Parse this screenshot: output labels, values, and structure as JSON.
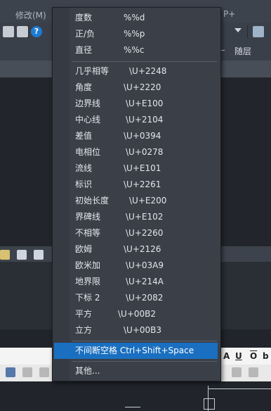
{
  "app": {
    "menubar_left_label": "修改(M)",
    "menubar_right_label": "P+",
    "layer_value": "随层",
    "help_icon_glyph": "?"
  },
  "editor": {
    "buttons": [
      "A",
      "U",
      "O",
      "b"
    ]
  },
  "symbol_menu": {
    "group1": [
      {
        "label": "度数",
        "code": "%%d"
      },
      {
        "label": "正/负",
        "code": "%%p"
      },
      {
        "label": "直径",
        "code": "%%c"
      }
    ],
    "group2": [
      {
        "label": "几乎相等",
        "code": "\\U+2248"
      },
      {
        "label": "角度",
        "code": "\\U+2220"
      },
      {
        "label": "边界线",
        "code": "\\U+E100"
      },
      {
        "label": "中心线",
        "code": "\\U+2104"
      },
      {
        "label": "差值",
        "code": "\\U+0394"
      },
      {
        "label": "电相位",
        "code": "\\U+0278"
      },
      {
        "label": "流线",
        "code": "\\U+E101"
      },
      {
        "label": "标识",
        "code": "\\U+2261"
      },
      {
        "label": "初始长度",
        "code": "\\U+E200"
      },
      {
        "label": "界碑线",
        "code": "\\U+E102"
      },
      {
        "label": "不相等",
        "code": "\\U+2260"
      },
      {
        "label": "欧姆",
        "code": "\\U+2126"
      },
      {
        "label": "欧米加",
        "code": "\\U+03A9"
      },
      {
        "label": "地界限",
        "code": "\\U+214A"
      },
      {
        "label": "下标 2",
        "code": "\\U+2082"
      },
      {
        "label": "平方",
        "code": "\\U+00B2"
      },
      {
        "label": "立方",
        "code": "\\U+00B3"
      }
    ],
    "group3": [
      {
        "label": "不间断空格 Ctrl+Shift+Space",
        "highlighted": true
      }
    ],
    "group4": [
      {
        "label": "其他..."
      }
    ]
  },
  "colors": {
    "menu_bg": "#3b4048",
    "highlight": "#1a6fc0",
    "help_icon": "#1e7bd2"
  }
}
